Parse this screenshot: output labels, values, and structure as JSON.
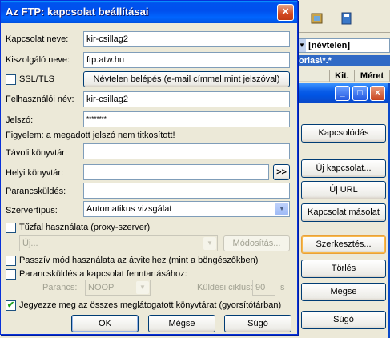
{
  "background": {
    "path": "[névtelen]",
    "filter": "orlas\\*.*",
    "columns": [
      "Kit.",
      "Méret"
    ],
    "buttons": [
      "Kapcsolódás",
      "Új kapcsolat...",
      "Új URL",
      "Kapcsolat másolat",
      "Szerkesztés...",
      "Törlés",
      "Mégse",
      "Súgó"
    ]
  },
  "dialog": {
    "title": "Az FTP: kapcsolat beállításai",
    "connection_name": {
      "label": "Kapcsolat neve:",
      "value": "kir-csillag2"
    },
    "server_name": {
      "label": "Kiszolgáló neve:",
      "value": "ftp.atw.hu"
    },
    "ssl": {
      "label": "SSL/TLS",
      "checked": false
    },
    "anonymous_button": "Névtelen belépés (e-mail címmel mint jelszóval)",
    "username": {
      "label": "Felhasználói név:",
      "value": "kir-csillag2"
    },
    "password": {
      "label": "Jelszó:",
      "value": "********"
    },
    "warning": "Figyelem: a megadott jelszó nem titkosított!",
    "remote_dir": {
      "label": "Távoli könyvtár:",
      "value": ""
    },
    "local_dir": {
      "label": "Helyi könyvtár:",
      "value": "",
      "browse": ">>"
    },
    "command": {
      "label": "Parancsküldés:",
      "value": ""
    },
    "server_type": {
      "label": "Szervertípus:",
      "value": "Automatikus vizsgálat"
    },
    "firewall": {
      "label": "Tűzfal használata (proxy-szerver)",
      "checked": false,
      "select": "Új...",
      "modify": "Módosítás..."
    },
    "passive": {
      "label": "Passzív mód használata az átvitelhez (mint a böngészőkben)",
      "checked": false
    },
    "keepalive": {
      "label": "Parancsküldés a kapcsolat fenntartásához:",
      "checked": false,
      "cmd_label": "Parancs:",
      "cmd_value": "NOOP",
      "interval_label": "Küldési ciklus:",
      "interval_value": "90",
      "interval_unit": "s"
    },
    "cache": {
      "label": "Jegyezze meg az összes meglátogatott könyvtárat (gyorsítótárban)",
      "checked": true
    },
    "ok": "OK",
    "cancel": "Mégse",
    "help": "Súgó"
  }
}
